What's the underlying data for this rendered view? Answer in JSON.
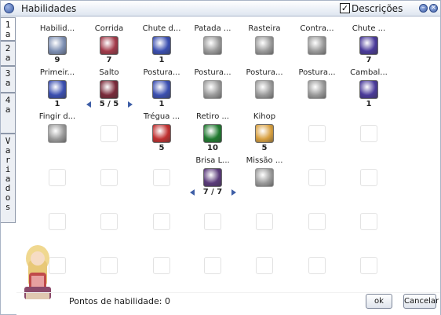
{
  "window": {
    "title": "Habilidades",
    "descriptions_label": "Descrições",
    "descriptions_checked": true,
    "minimize_icon": "minimize-icon",
    "close_icon": "close-icon"
  },
  "tabs": [
    {
      "label": "1a",
      "chars": [
        "1",
        "a"
      ],
      "active": true
    },
    {
      "label": "2a",
      "chars": [
        "2",
        "a"
      ],
      "active": false
    },
    {
      "label": "3a",
      "chars": [
        "3",
        "a"
      ],
      "active": false
    },
    {
      "label": "4a",
      "chars": [
        "4",
        "a"
      ],
      "active": false
    },
    {
      "label": "Variados",
      "chars": [
        "V",
        "a",
        "r",
        "i",
        "a",
        "d",
        "o",
        "s"
      ],
      "active": false
    }
  ],
  "skills": {
    "r0c0": {
      "name": "Habilid...",
      "level": "9",
      "icon": "skill-cloud-icon",
      "color": "#7d8fb3"
    },
    "r0c1": {
      "name": "Corrida",
      "level": "7",
      "icon": "skill-run-icon",
      "color": "#a23a4a"
    },
    "r0c2": {
      "name": "Chute d...",
      "level": "1",
      "icon": "skill-kick-icon",
      "color": "#3b4fb0"
    },
    "r0c3": {
      "name": "Patada ...",
      "level": "",
      "icon": "skill-stomp-icon",
      "color": "#9a9a9a"
    },
    "r0c4": {
      "name": "Rasteira",
      "level": "",
      "icon": "skill-sweep-icon",
      "color": "#9a9a9a"
    },
    "r0c5": {
      "name": "Contra...",
      "level": "",
      "icon": "skill-counter-icon",
      "color": "#9a9a9a"
    },
    "r0c6": {
      "name": "Chute ...",
      "level": "7",
      "icon": "skill-flip-kick-icon",
      "color": "#4a3a9a"
    },
    "r1c0": {
      "name": "Primeir...",
      "level": "1",
      "icon": "skill-hand-icon",
      "color": "#3b4fb0"
    },
    "r1c1": {
      "name": "Salto",
      "level": "5 / 5",
      "icon": "skill-leap-icon",
      "color": "#7a2a3a"
    },
    "r1c2": {
      "name": "Postura...",
      "level": "1",
      "icon": "skill-stance-kick-icon",
      "color": "#3b4fb0"
    },
    "r1c3": {
      "name": "Postura...",
      "level": "",
      "icon": "skill-stance-stomp-icon",
      "color": "#9a9a9a"
    },
    "r1c4": {
      "name": "Postura...",
      "level": "",
      "icon": "skill-stance-sweep-icon",
      "color": "#9a9a9a"
    },
    "r1c5": {
      "name": "Postura...",
      "level": "",
      "icon": "skill-stance-counter-icon",
      "color": "#9a9a9a"
    },
    "r1c6": {
      "name": "Cambal...",
      "level": "1",
      "icon": "skill-tumble-icon",
      "color": "#4a3a9a"
    },
    "r2c0": {
      "name": "Fingir d...",
      "level": "",
      "icon": "skill-play-dead-icon",
      "color": "#9a9a9a"
    },
    "r2c2": {
      "name": "Trégua ...",
      "level": "5",
      "icon": "skill-hp-rest-icon",
      "color": "#c03030"
    },
    "r2c3": {
      "name": "Retiro ...",
      "level": "10",
      "icon": "skill-sp-rest-icon",
      "color": "#207a30"
    },
    "r2c4": {
      "name": "Kihop",
      "level": "5",
      "icon": "skill-kihop-icon",
      "color": "#d8a040"
    },
    "r3c3": {
      "name": "Brisa L...",
      "level": "7 / 7",
      "icon": "skill-breeze-icon",
      "color": "#5a3a7a"
    },
    "r3c4": {
      "name": "Missão ...",
      "level": "",
      "icon": "skill-quest-icon",
      "color": "#9a9a9a"
    }
  },
  "points_label": "Pontos de habilidade: 0",
  "buttons": {
    "ok": "ok",
    "cancel": "Cancelar"
  },
  "character": {
    "icon": "character-portrait-icon"
  }
}
